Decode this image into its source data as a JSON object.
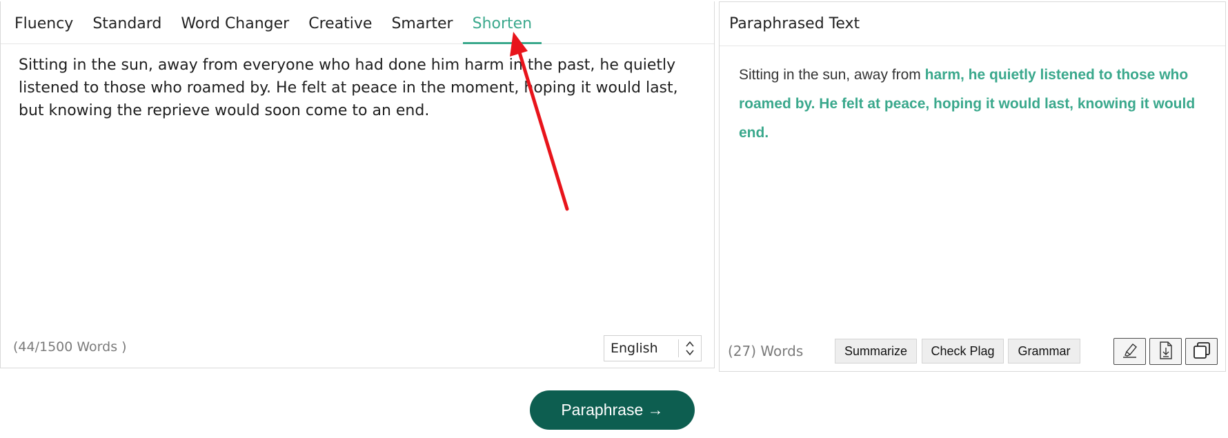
{
  "tabs": [
    {
      "label": "Fluency",
      "active": false
    },
    {
      "label": "Standard",
      "active": false
    },
    {
      "label": "Word Changer",
      "active": false
    },
    {
      "label": "Creative",
      "active": false
    },
    {
      "label": "Smarter",
      "active": false
    },
    {
      "label": "Shorten",
      "active": true
    }
  ],
  "input": {
    "text": "Sitting in the sun, away from everyone who had done him harm in the past, he quietly listened to those who roamed by. He felt at peace in the moment, hoping it would last, but knowing the reprieve would soon come to an end.",
    "word_count": "(44/1500 Words )",
    "language": "English"
  },
  "output": {
    "header": "Paraphrased Text",
    "plain_part": "Sitting in the sun, away from ",
    "changed_part": "harm, he quietly listened to those who roamed by. He felt at peace, hoping it would last, knowing it would end.",
    "word_count": "(27) Words",
    "actions": {
      "summarize": "Summarize",
      "check_plag": "Check Plag",
      "grammar": "Grammar"
    },
    "icons": [
      "highlighter-icon",
      "download-icon",
      "copy-icon"
    ]
  },
  "paraphrase_button": "Paraphrase →",
  "colors": {
    "accent": "#3aa88c",
    "primary_button": "#0d5e50",
    "annotation_arrow": "#e8141b"
  }
}
